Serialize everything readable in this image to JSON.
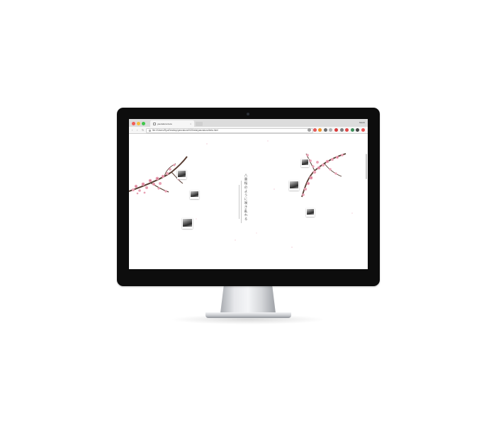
{
  "browser": {
    "tab_title": "yaezakura.beta",
    "tab_close": "×",
    "profile_label": "Moshi",
    "nav": {
      "back": "‹",
      "forward": "›",
      "reload": "↻"
    },
    "url": "file:///Users/Ryo/Desktop/yaezakura%20beta/yaezakura/beta.html",
    "menu": "⋮",
    "extension_colors": [
      "#9e9e9e",
      "#e55a5a",
      "#f0932b",
      "#6d6d6d",
      "#b0b0b0",
      "#d83b3b",
      "#7d7d7d",
      "#e04848",
      "#3d8f5a",
      "#444444",
      "#f05050"
    ]
  },
  "page": {
    "vertical_text": "八重桜のように咲き乱れる",
    "left_captions": [
      "",
      "",
      ""
    ],
    "right_captions": [
      "",
      "",
      ""
    ]
  },
  "colors": {
    "blossom": "#e9a3b5",
    "blossom_dark": "#c9607c",
    "branch": "#5a3f35",
    "bezel": "#0d0d0d"
  }
}
